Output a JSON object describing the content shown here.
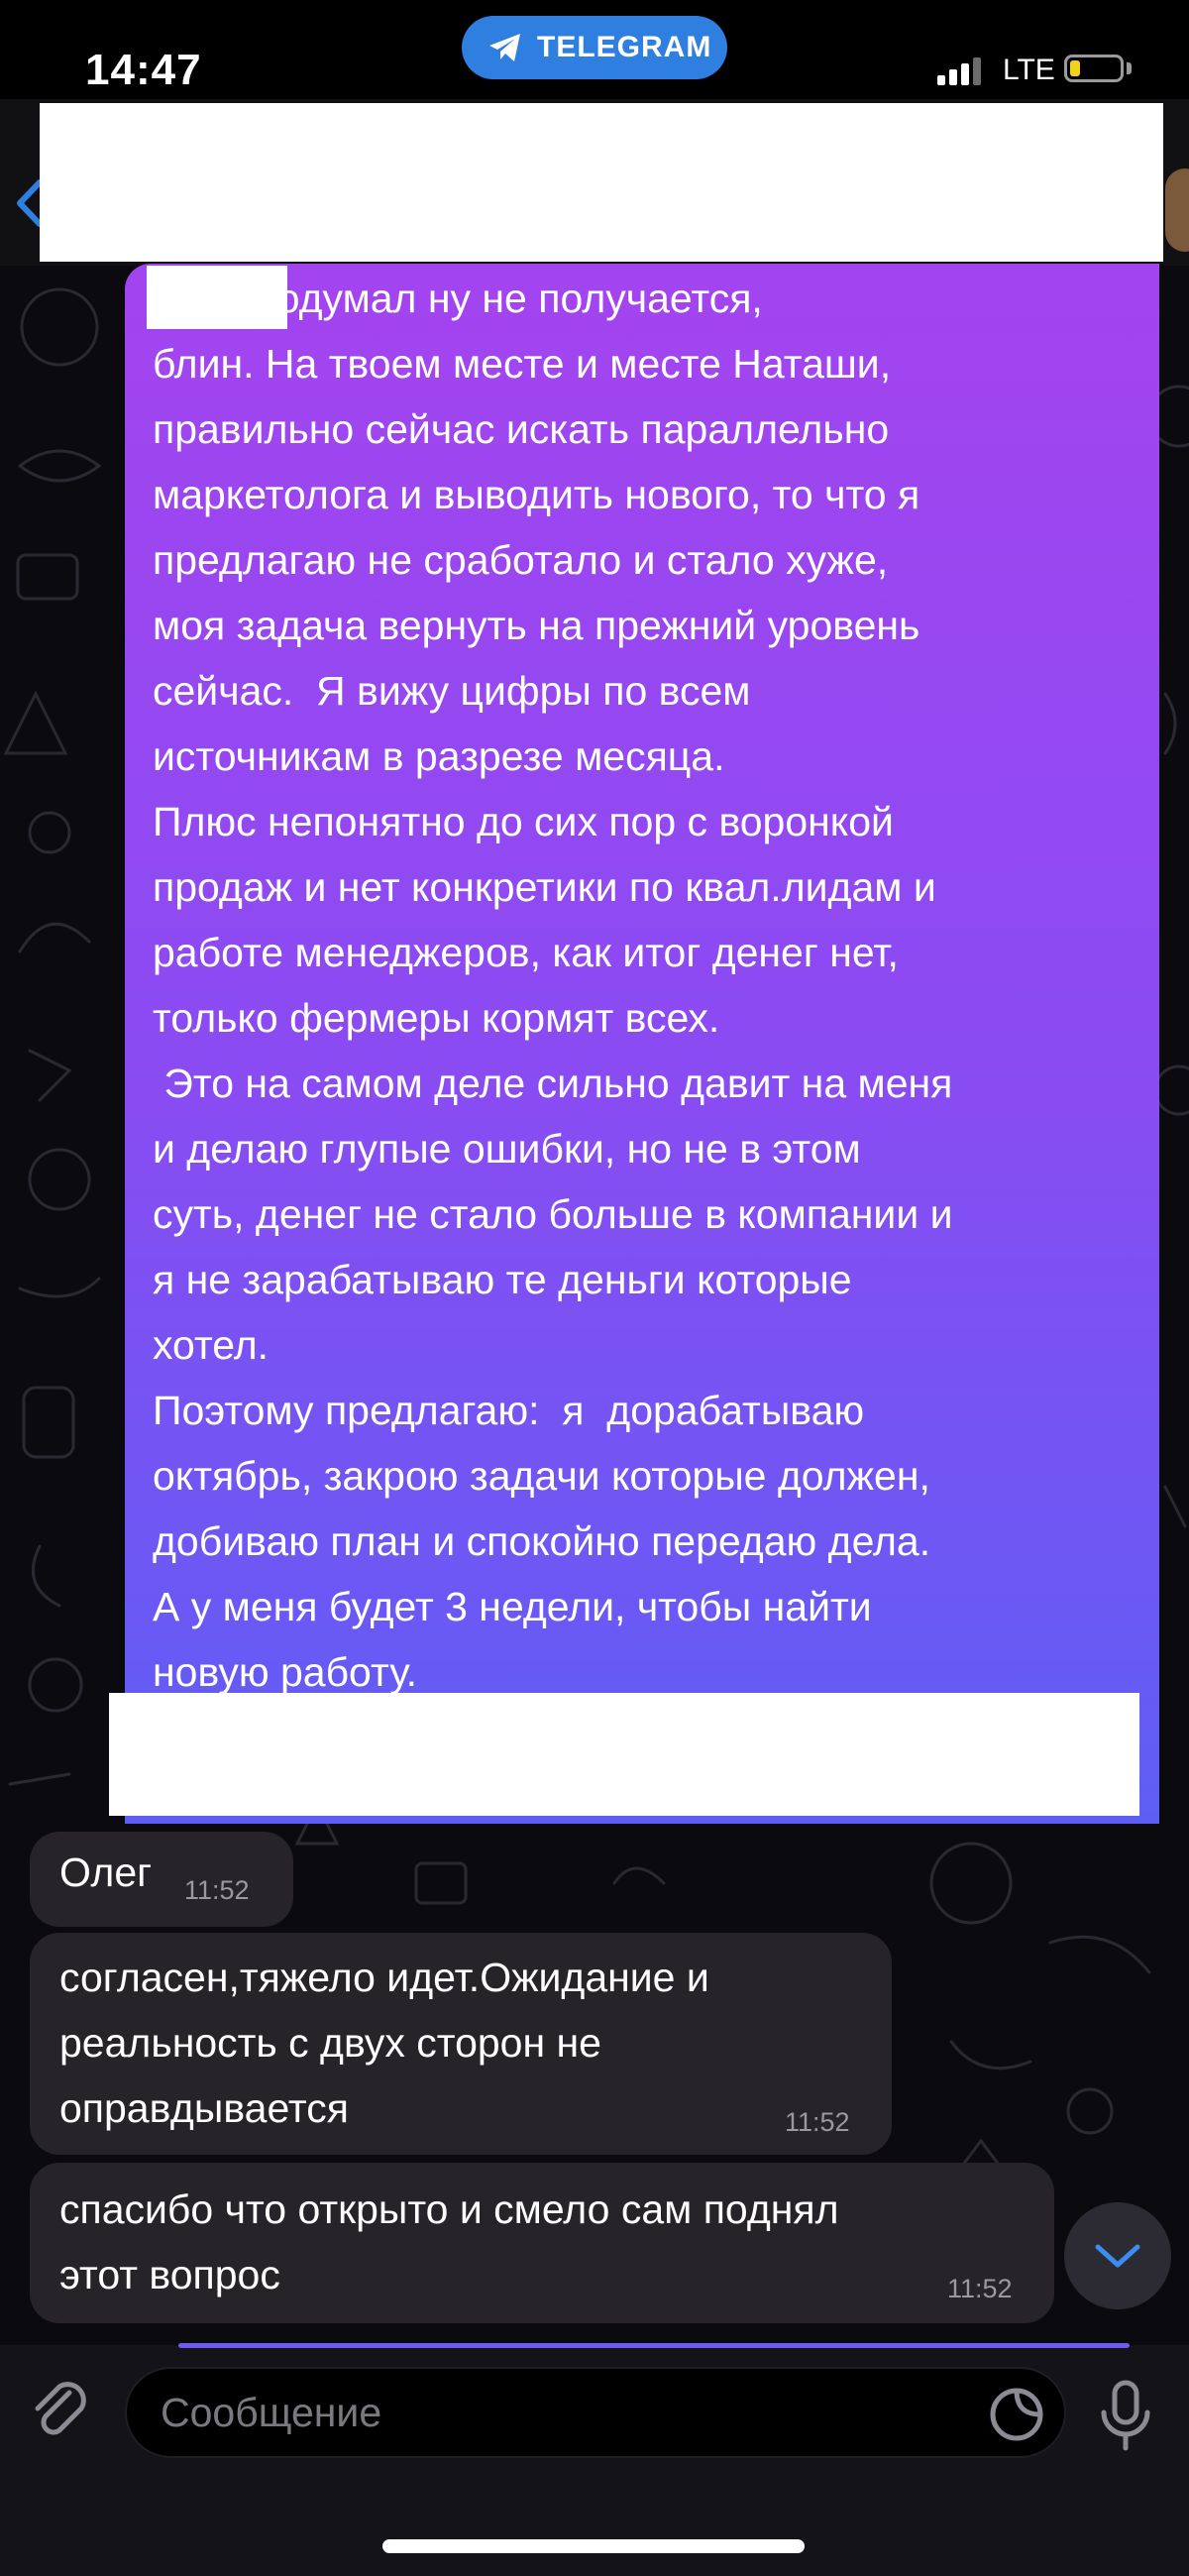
{
  "status_bar": {
    "time": "14:47",
    "telegram_label": "TELEGRAM",
    "network": "LTE",
    "battery_level": 0.2
  },
  "outgoing_message": {
    "text": "я тут подумал ну не получается,\nблин. На твоем месте и месте Наташи,\nправильно сейчас искать параллельно\nмаркетолога и выводить нового, то что я\nпредлагаю не сработало и стало хуже,\nмоя задача вернуть на прежний уровень\nсейчас.  Я вижу цифры по всем\nисточникам в разрезе месяца.\nПлюс непонятно до сих пор с воронкой\nпродаж и нет конкретики по квал.лидам и\nработе менеджеров, как итог денег нет,\nтолько фермеры кормят всех.\n Это на самом деле сильно давит на меня\nи делаю глупые ошибки, но не в этом\nсуть, денег не стало больше в компании и\nя не зарабатываю те деньги которые\nхотел.\nПоэтому предлагаю:  я  дорабатываю\nоктябрь, закрою задачи которые должен,\nдобиваю план и спокойно передаю дела.\nА у меня будет 3 недели, чтобы найти\nновую работу."
  },
  "incoming_messages": [
    {
      "sender": "Олег",
      "text": "",
      "time": "11:52"
    },
    {
      "text": "согласен,тяжело идет.Ожидание и\nреальность с двух сторон не\nоправдывается",
      "time": "11:52"
    },
    {
      "text": "спасибо что открыто и смело сам поднял\nэтот вопрос",
      "time": "11:52"
    }
  ],
  "composer": {
    "placeholder": "Сообщение"
  },
  "colors": {
    "accent": "#2f7fe0",
    "outgoing_gradient_top": "#a344ef",
    "outgoing_gradient_bottom": "#5e5ef5",
    "incoming_bubble": "#262329"
  }
}
